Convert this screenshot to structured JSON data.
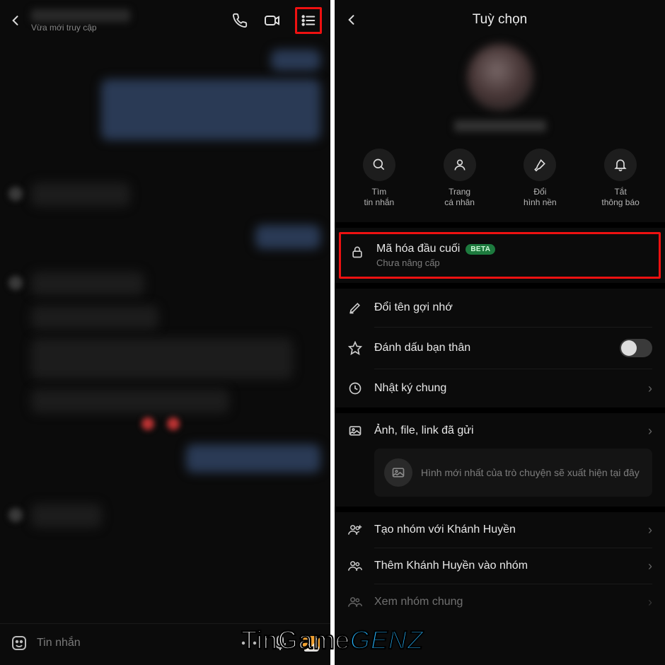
{
  "left": {
    "status": "Vừa mới truy cập",
    "composer_placeholder": "Tin nhắn"
  },
  "right": {
    "header_title": "Tuỳ chọn",
    "quick": [
      {
        "label": "Tìm\ntin nhắn"
      },
      {
        "label": "Trang\ncá nhân"
      },
      {
        "label": "Đổi\nhình nền"
      },
      {
        "label": "Tắt\nthông báo"
      }
    ],
    "encryption": {
      "title": "Mã hóa đầu cuối",
      "badge": "BETA",
      "sub": "Chưa nâng cấp"
    },
    "options": {
      "rename": "Đổi tên gợi nhớ",
      "bestfriend": "Đánh dấu bạn thân",
      "diary": "Nhật ký chung",
      "media": "Ảnh, file, link đã gửi",
      "media_preview": "Hình mới nhất của trò chuyện sẽ xuất hiện tại đây",
      "create_group": "Tạo nhóm với Khánh Huyền",
      "add_to_group": "Thêm Khánh Huyền vào nhóm",
      "view_common_groups": "Xem nhóm chung"
    }
  },
  "watermark": {
    "a": "TinGame",
    "b": "GENZ"
  }
}
